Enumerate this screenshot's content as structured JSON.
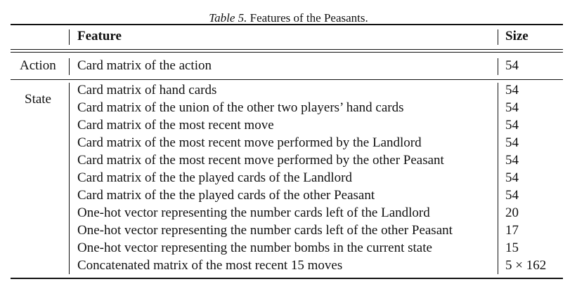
{
  "caption": {
    "label": "Table 5.",
    "text": " Features of the Peasants."
  },
  "header": {
    "feature": "Feature",
    "size": "Size"
  },
  "action": {
    "label": "Action",
    "feature": "Card matrix of the action",
    "size": "54"
  },
  "state": {
    "label": "State",
    "rows": [
      {
        "feature": "Card matrix of hand cards",
        "size": "54"
      },
      {
        "feature": "Card matrix of the union of the other two players’ hand cards",
        "size": "54"
      },
      {
        "feature": "Card matrix of the most recent move",
        "size": "54"
      },
      {
        "feature": "Card matrix of the most recent move performed by the Landlord",
        "size": "54"
      },
      {
        "feature": "Card matrix of the most recent move performed by the other Peasant",
        "size": "54"
      },
      {
        "feature": "Card matrix of the the played cards of the Landlord",
        "size": "54"
      },
      {
        "feature": "Card matrix of the the played cards of the other Peasant",
        "size": "54"
      },
      {
        "feature": "One-hot vector representing the number cards left of the Landlord",
        "size": "20"
      },
      {
        "feature": "One-hot vector representing the number cards left of the other Peasant",
        "size": "17"
      },
      {
        "feature": "One-hot vector representing the number bombs in the current state",
        "size": "15"
      },
      {
        "feature": "Concatenated matrix of the most recent 15 moves",
        "size": "5 × 162"
      }
    ]
  }
}
